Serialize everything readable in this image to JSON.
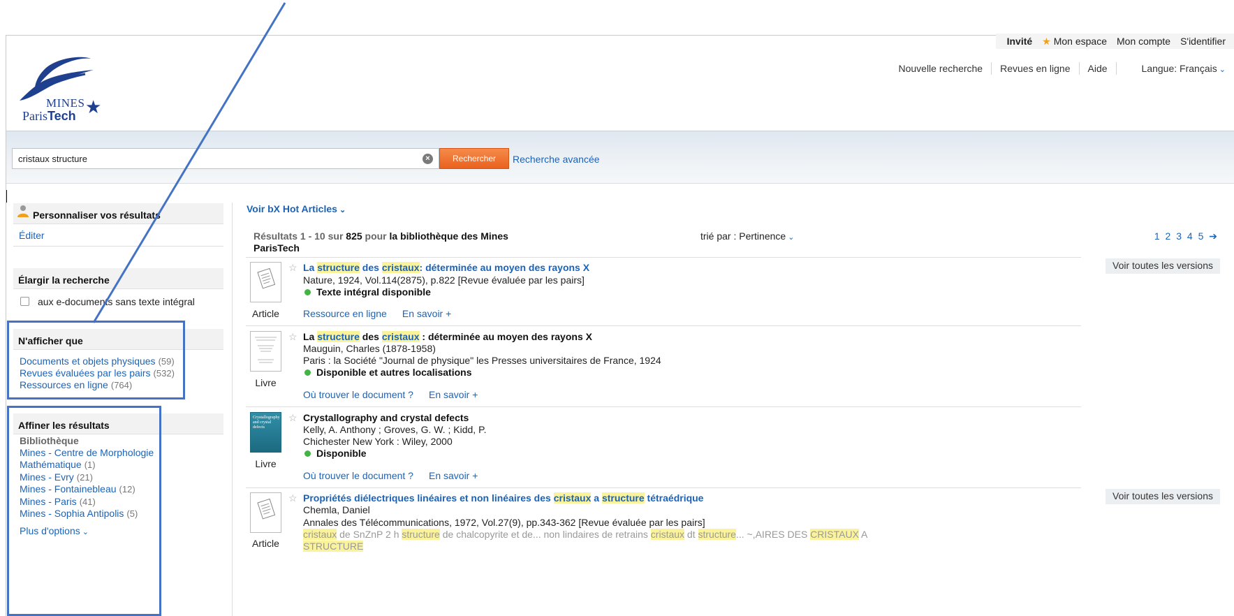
{
  "header": {
    "guest": "Invité",
    "my_space": "Mon espace",
    "my_account": "Mon compte",
    "sign_in": "S'identifier",
    "nav": [
      "Nouvelle recherche",
      "Revues en ligne",
      "Aide"
    ],
    "language": "Langue: Français"
  },
  "logo": {
    "line1": "MINES",
    "line2_a": "Paris",
    "line2_b": "Tech"
  },
  "search": {
    "query": "cristaux structure",
    "button": "Rechercher",
    "advanced": "Recherche avancée"
  },
  "sidebar": {
    "personalize": {
      "title": "Personnaliser vos résultats",
      "edit": "Éditer"
    },
    "expand": {
      "title": "Élargir la recherche",
      "checkbox_label": "aux e-documents sans texte intégral"
    },
    "show_only": {
      "title": "N'afficher que",
      "items": [
        {
          "label": "Documents et objets physiques",
          "count": "(59)"
        },
        {
          "label": "Revues évaluées par les pairs",
          "count": "(532)"
        },
        {
          "label": "Ressources en ligne",
          "count": "(764)"
        }
      ]
    },
    "refine": {
      "title": "Affiner les résultats",
      "group": "Bibliothèque",
      "items": [
        {
          "label": "Mines - Centre de Morphologie",
          "label2": "Mathématique",
          "count": "(1)"
        },
        {
          "label": "Mines - Evry",
          "count": "(21)"
        },
        {
          "label": "Mines - Fontainebleau",
          "count": "(12)"
        },
        {
          "label": "Mines - Paris",
          "count": "(41)"
        },
        {
          "label": "Mines - Sophia Antipolis",
          "count": "(5)"
        }
      ],
      "more": "Plus d'options"
    }
  },
  "results_header": {
    "hot_articles": "Voir bX Hot Articles",
    "summary_prefix": "Résultats 1 - 10 sur",
    "total": "825",
    "summary_for": "pour",
    "library": "la bibliothèque des Mines ParisTech",
    "sort_label": "trié par :",
    "sort_value": "Pertinence",
    "pages": "1 2 3 4 5"
  },
  "results": [
    {
      "title_parts": [
        "La ",
        "structure",
        " des ",
        "cristaux",
        ": déterminée au moyen des rayons X"
      ],
      "line1": "Nature, 1924, Vol.114(2875), p.822 [Revue évaluée par les pairs]",
      "availability": "Texte intégral disponible",
      "type": "Article",
      "links": [
        "Ressource en ligne",
        "En savoir +"
      ],
      "versions": "Voir toutes les versions"
    },
    {
      "title_parts": [
        "La ",
        "structure",
        " des ",
        "cristaux",
        " : déterminée au moyen des rayons X"
      ],
      "line1": "Mauguin, Charles (1878-1958)",
      "line2": "Paris : la Société \"Journal de physique\" les Presses universitaires de France, 1924",
      "availability": "Disponible et autres localisations",
      "type": "Livre",
      "links": [
        "Où trouver le document ?",
        "En savoir +"
      ]
    },
    {
      "title": "Crystallography and crystal defects",
      "line1": "Kelly, A. Anthony ; Groves, G. W. ; Kidd, P.",
      "line2": "Chichester New York : Wiley, 2000",
      "availability": "Disponible",
      "type": "Livre",
      "links": [
        "Où trouver le document ?",
        "En savoir +"
      ],
      "cover_text": "Crystallography and crystal defects"
    },
    {
      "title_parts": [
        "Propriétés diélectriques linéaires et non linéaires des ",
        "cristaux",
        " a ",
        "structure",
        " tétraédrique"
      ],
      "line1": "Chemla, Daniel",
      "line2": "Annales des Télécommunications, 1972, Vol.27(9), pp.343-362 [Revue évaluée par les pairs]",
      "snippet_parts": [
        "cristaux",
        " de SnZnP 2 h ",
        "structure",
        " de chalcopyrite et de... non lindaires de retrains ",
        "cristaux",
        " dt ",
        "structure",
        "... ~,AIRES DES ",
        "CRISTAUX",
        " A"
      ],
      "snippet_line2": "STRUCTURE",
      "type": "Article",
      "versions": "Voir toutes les versions"
    }
  ],
  "colors": {
    "link": "#1a63b8",
    "highlight": "#fbf39c",
    "search_button": "#ef6e2b",
    "annotation": "#4472c4",
    "available": "#43b343"
  },
  "icons": [
    "person-icon",
    "star-icon",
    "clear-icon",
    "chevron-down-icon",
    "arrow-right-icon",
    "favorite-star-icon",
    "document-icon"
  ]
}
